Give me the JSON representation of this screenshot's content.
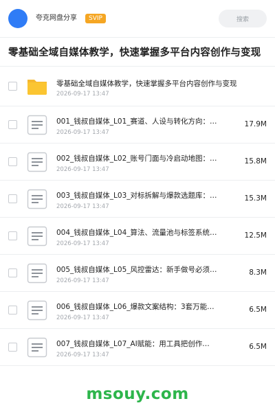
{
  "header": {
    "share_name": "夸克网盘分享",
    "vip_badge": "SVIP",
    "search_placeholder": "搜索"
  },
  "page_title": "零基础全域自媒体教学，快速掌握多平台内容创作与变现",
  "folder": {
    "name": "零基础全域自媒体教学，快速掌握多平台内容创作与变现",
    "date": "2026-09-17 13:47",
    "icon": "folder-icon"
  },
  "files": [
    {
      "name": "001_钱叔自媒体_L01_赛道、人设与转化方向：…",
      "date": "2026-09-17 13:47",
      "size": "17.9M",
      "icon": "document-icon"
    },
    {
      "name": "002_钱叔自媒体_L02_账号门面与冷启动地图：…",
      "date": "2026-09-17 13:47",
      "size": "15.8M",
      "icon": "document-icon"
    },
    {
      "name": "003_钱叔自媒体_L03_对标拆解与爆款选题库：…",
      "date": "2026-09-17 13:47",
      "size": "15.3M",
      "icon": "document-icon"
    },
    {
      "name": "004_钱叔自媒体_L04_算法、流量池与标签系统…",
      "date": "2026-09-17 13:47",
      "size": "12.5M",
      "icon": "document-icon"
    },
    {
      "name": "005_钱叔自媒体_L05_风控雷达：新手做号必须…",
      "date": "2026-09-17 13:47",
      "size": "8.3M",
      "icon": "document-icon"
    },
    {
      "name": "006_钱叔自媒体_L06_爆款文案结构：3套万能…",
      "date": "2026-09-17 13:47",
      "size": "6.5M",
      "icon": "document-icon"
    },
    {
      "name": "007_钱叔自媒体_L07_AI赋能：用工具把创作…",
      "date": "2026-09-17 13:47",
      "size": "6.5M",
      "icon": "document-icon"
    }
  ],
  "footer": {
    "watermark": "msouy.com"
  },
  "colors": {
    "avatar": "#2f7cf6",
    "vip": "#f5a623",
    "folder": "#fbc531",
    "watermark": "#2db54b",
    "background": "#f2f3f5"
  }
}
